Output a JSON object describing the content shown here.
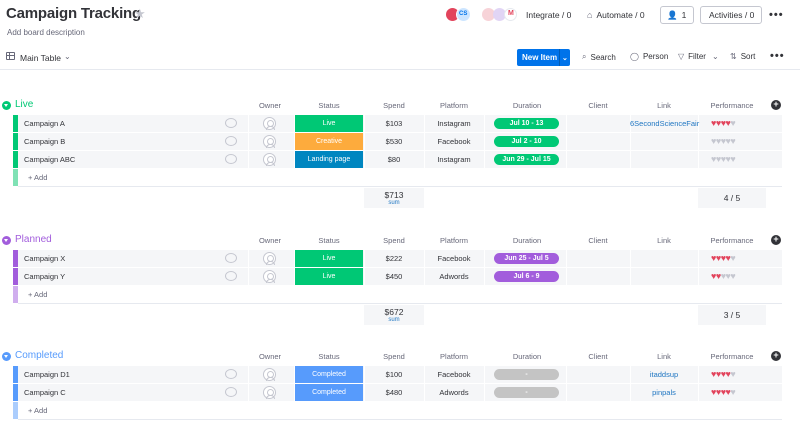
{
  "board": {
    "title": "Campaign Tracking",
    "description": "Add board description"
  },
  "header": {
    "integrate_label": "Integrate / 0",
    "automate_label": "Automate / 0",
    "people_count": "1",
    "activities_label": "Activities / 0",
    "integration_mail_glyph": "M"
  },
  "toolbar": {
    "view_label": "Main Table",
    "new_item_label": "New Item",
    "search_label": "Search",
    "person_label": "Person",
    "filter_label": "Filter",
    "sort_label": "Sort"
  },
  "columns": [
    "Owner",
    "Status",
    "Spend",
    "Platform",
    "Duration",
    "Client",
    "Link",
    "Performance"
  ],
  "add_item_label": "+ Add",
  "sum_label": "sum",
  "colors": {
    "status_live": "#00c875",
    "status_creative": "#fdab3d",
    "status_landing": "#0086c0",
    "status_completed": "#579bfc",
    "duration_green": "#00c875",
    "duration_purple": "#a25ddc",
    "duration_gray": "#c4c4c4",
    "heart_on": "#e2445c",
    "heart_off": "#c5c7d0"
  },
  "groups": [
    {
      "title": "Live",
      "color": "#00c875",
      "light": "#80e2b5",
      "rows": [
        {
          "name": "Campaign A",
          "status": "Live",
          "status_color": "#00c875",
          "spend": "$103",
          "platform": "Instagram",
          "duration": "Jul 10 - 13",
          "duration_color": "#00c875",
          "link": "6SecondScienceFair",
          "rating": 4
        },
        {
          "name": "Campaign B",
          "status": "Creative",
          "status_color": "#fdab3d",
          "spend": "$530",
          "platform": "Facebook",
          "duration": "Jul 2 - 10",
          "duration_color": "#00c875",
          "link": "",
          "rating": 0
        },
        {
          "name": "Campaign ABC",
          "status": "Landing page",
          "status_color": "#0086c0",
          "spend": "$80",
          "platform": "Instagram",
          "duration": "Jun 29 - Jul 15",
          "duration_color": "#00c875",
          "link": "",
          "rating": 0
        }
      ],
      "sum": "$713",
      "performance": "4 / 5"
    },
    {
      "title": "Planned",
      "color": "#a25ddc",
      "light": "#d0aeee",
      "rows": [
        {
          "name": "Campaign X",
          "status": "Live",
          "status_color": "#00c875",
          "spend": "$222",
          "platform": "Facebook",
          "duration": "Jun 25 - Jul 5",
          "duration_color": "#a25ddc",
          "link": "",
          "rating": 4
        },
        {
          "name": "Campaign Y",
          "status": "Live",
          "status_color": "#00c875",
          "spend": "$450",
          "platform": "Adwords",
          "duration": "Jul 6 - 9",
          "duration_color": "#a25ddc",
          "link": "",
          "rating": 2
        }
      ],
      "sum": "$672",
      "performance": "3 / 5"
    },
    {
      "title": "Completed",
      "color": "#579bfc",
      "light": "#abcdfd",
      "rows": [
        {
          "name": "Campaign D1",
          "status": "Completed",
          "status_color": "#579bfc",
          "spend": "$100",
          "platform": "Facebook",
          "duration": "-",
          "duration_color": "#c4c4c4",
          "link": "itaddsup",
          "rating": 4
        },
        {
          "name": "Campaign C",
          "status": "Completed",
          "status_color": "#579bfc",
          "spend": "$480",
          "platform": "Adwords",
          "duration": "-",
          "duration_color": "#c4c4c4",
          "link": "pinpals",
          "rating": 4
        }
      ]
    }
  ]
}
